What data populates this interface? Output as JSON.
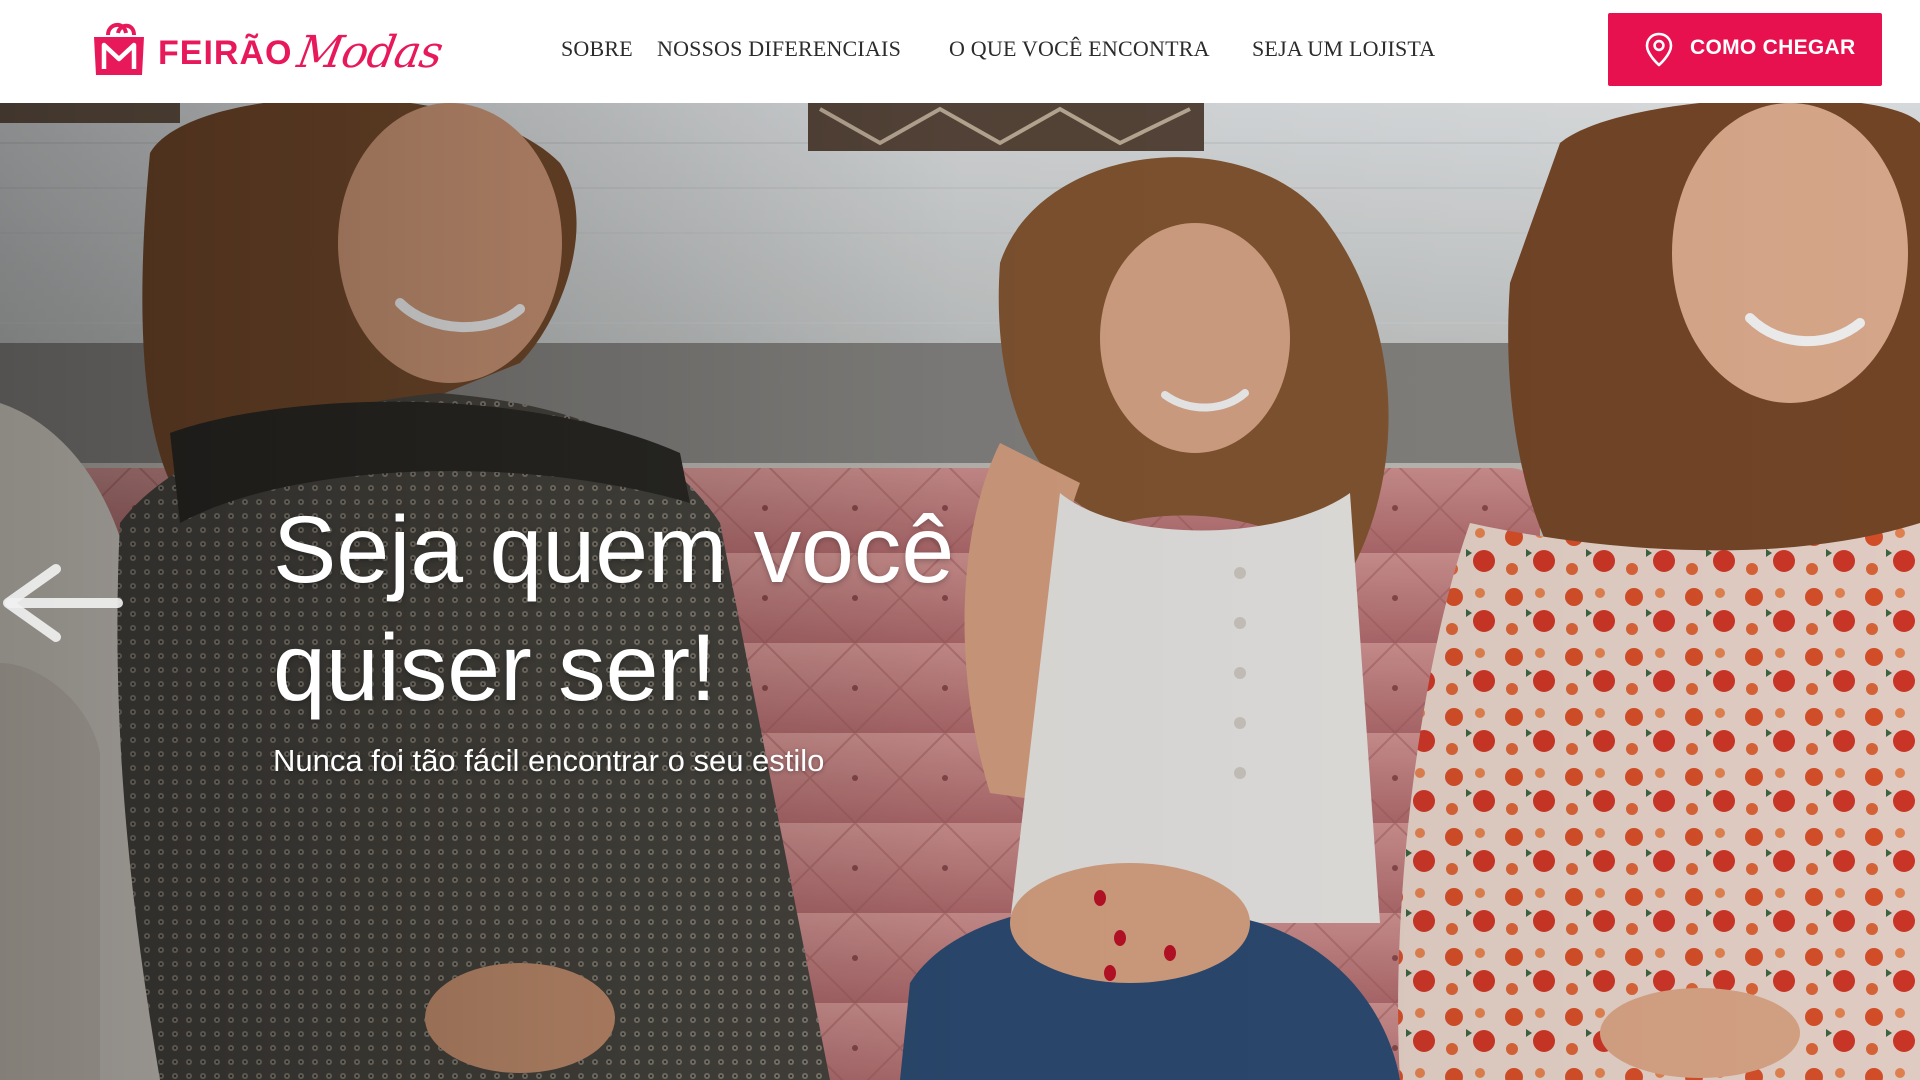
{
  "header": {
    "logo": {
      "brand": "FEIRÃO",
      "script": "Modas"
    },
    "nav": {
      "sobre": "SOBRE",
      "diferenciais": "NOSSOS DIFERENCIAIS",
      "encontra": "O QUE VOCÊ ENCONTRA",
      "lojista": "SEJA UM LOJISTA"
    },
    "cta": {
      "label": "COMO CHEGAR",
      "icon": "map-pin-icon"
    }
  },
  "hero": {
    "title": "Seja quem você quiser ser!",
    "subtitle": "Nunca foi tão fácil encontrar o seu estilo",
    "prev_icon": "arrow-left-icon"
  },
  "colors": {
    "brand": "#e8195a",
    "cta_background": "#e8114f",
    "nav_text": "#2b2b2b",
    "hero_text": "#ffffff"
  }
}
